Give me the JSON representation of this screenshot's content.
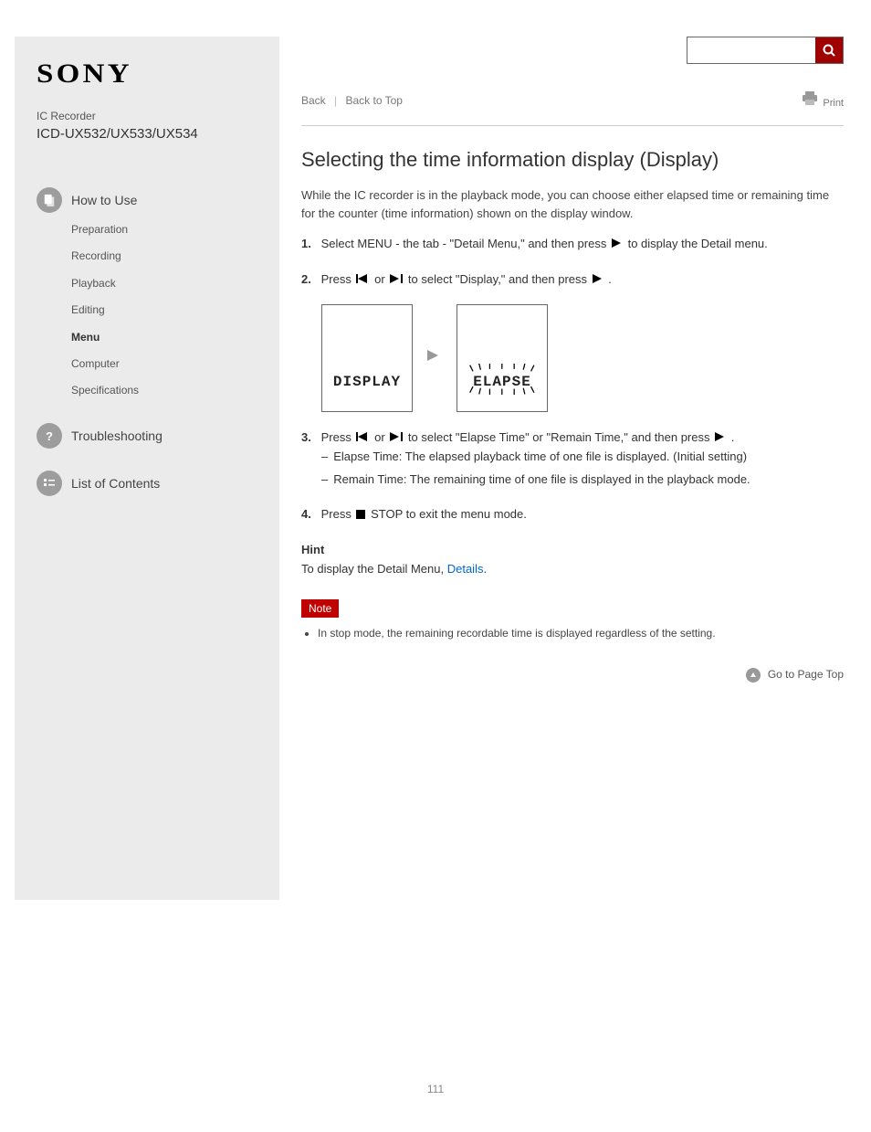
{
  "brand": "SONY",
  "product": {
    "line": "IC Recorder",
    "model": "ICD-UX532/UX533/UX534"
  },
  "sidebar": {
    "howto": {
      "label": "How to Use",
      "items": [
        "Preparation",
        "Recording",
        "Playback",
        "Editing",
        "Menu",
        "Computer",
        "Specifications"
      ]
    },
    "trouble": {
      "label": "Troubleshooting"
    },
    "contents": {
      "label": "List of Contents"
    }
  },
  "search": {
    "placeholder": ""
  },
  "breadcrumb": {
    "a": "Back",
    "b": "Back to Top"
  },
  "print_label": "Print",
  "title": "Selecting the time information display (Display)",
  "intro": "While the IC recorder is in the playback mode, you can choose either elapsed time or remaining time for the counter (time information) shown on the display window.",
  "steps": {
    "s1a": "Select MENU - the  tab - \"Detail Menu,\" and then press ",
    "s1b": " to display the Detail menu.",
    "s2a": "Press ",
    "s2b": " or ",
    "s2c": " to select \"Display,\" and then press ",
    "s2d": ".",
    "s3a": "Press ",
    "s3b": " or ",
    "s3c": " to select \"Elapse Time\" or \"Remain Time,\" and then press ",
    "s3d": ".",
    "s3_bullets": [
      "Elapse Time: The elapsed playback time of one file is displayed. (Initial setting)",
      "Remain Time: The remaining time of one file is displayed in the playback mode."
    ],
    "s4a": "Press ",
    "s4b": "STOP to exit the menu mode."
  },
  "diagram": {
    "left": "DISPLAY",
    "right": "ELAPSE"
  },
  "hint_label": "Hint",
  "hint_text_a": "To display the Detail Menu,",
  "hint_link": "Details",
  "hint_text_b": ".",
  "note_label": "Note",
  "note_text": "In stop mode, the remaining recordable time is displayed regardless of the setting.",
  "goto_top": "Go to Page Top",
  "page_number": "111"
}
